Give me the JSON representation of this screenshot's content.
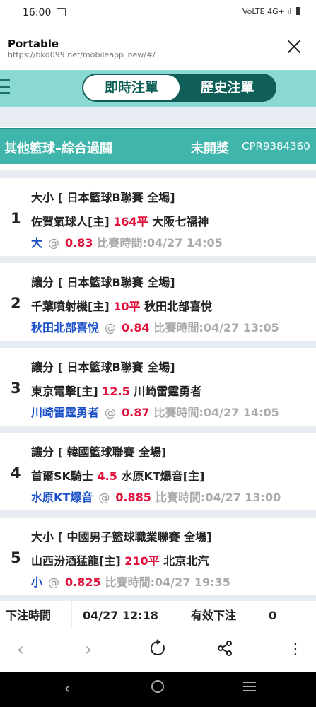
{
  "status_bar": {
    "time": "16:00",
    "network": "VoLTE 4G+"
  },
  "browser": {
    "title": "Portable",
    "url": "https://bkd099.net/mobileapp_new/#/"
  },
  "tabs": {
    "live": "即時注單",
    "history": "歷史注單"
  },
  "bet": {
    "type": "其他籃球–綜合過關",
    "status": "未開獎",
    "id": "CPR9384360",
    "legs": [
      {
        "num": "1",
        "market": "大小 [ 日本籃球B聯賽 全場]",
        "home": "佐賀氣球人[主]",
        "line": "164平",
        "away": "大阪七福神",
        "pick": "大",
        "at": "@",
        "odds": "0.83",
        "time": "比賽時間:04/27 14:05"
      },
      {
        "num": "2",
        "market": "讓分 [ 日本籃球B聯賽 全場]",
        "home": "千葉噴射機[主]",
        "line": "10平",
        "away": "秋田北部喜悅",
        "pick": "秋田北部喜悅",
        "at": "@",
        "odds": "0.84",
        "time": "比賽時間:04/27 13:05"
      },
      {
        "num": "3",
        "market": "讓分 [ 日本籃球B聯賽 全場]",
        "home": "東京電擊[主]",
        "line": "12.5",
        "away": "川崎雷霆勇者",
        "pick": "川崎雷霆勇者",
        "at": "@",
        "odds": "0.87",
        "time": "比賽時間:04/27 14:05"
      },
      {
        "num": "4",
        "market": "讓分 [ 韓國籃球聯賽 全場]",
        "home": "首爾SK騎士",
        "line": "4.5",
        "away": "水原KT爆音[主]",
        "pick": "水原KT爆音",
        "at": "@",
        "odds": "0.885",
        "time": "比賽時間:04/27 13:00"
      },
      {
        "num": "5",
        "market": "大小 [ 中國男子籃球職業聯賽 全場]",
        "home": "山西汾酒猛龍[主]",
        "line": "210平",
        "away": "北京北汽",
        "pick": "小",
        "at": "@",
        "odds": "0.825",
        "time": "比賽時間:04/27 19:35"
      }
    ]
  },
  "summary": {
    "bet_time_label": "下注時間",
    "bet_time_value": "04/27 12:18",
    "valid_bet_label": "有效下注",
    "valid_bet_value": "0"
  },
  "toolbar": {
    "back_icon": "chevron-left-icon",
    "forward_icon": "chevron-right-icon",
    "reload_icon": "reload-icon",
    "share_icon": "share-icon",
    "more_icon": "more-vertical-icon"
  },
  "colors": {
    "teal_light": "#8ad8d2",
    "teal_dark": "#0f5f58",
    "header_teal": "#3fb5ab",
    "odds_red": "#e0103a",
    "pick_blue": "#1a4fc9"
  }
}
